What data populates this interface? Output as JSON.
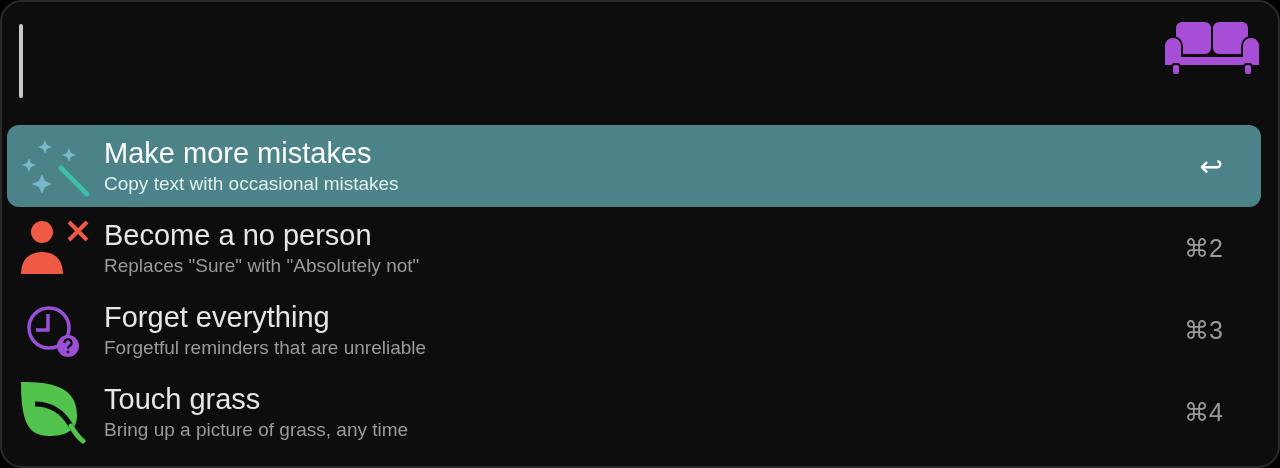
{
  "search": {
    "focused": true
  },
  "items": [
    {
      "kind": "wand",
      "title": "Make more mistakes",
      "subtitle": "Copy text with occasional mistakes",
      "shortcut": "↩",
      "selected": true
    },
    {
      "kind": "person-x",
      "title": "Become a no person",
      "subtitle": "Replaces \"Sure\" with \"Absolutely not\"",
      "shortcut": "⌘2",
      "selected": false
    },
    {
      "kind": "clock-question",
      "title": "Forget everything",
      "subtitle": "Forgetful reminders that are unreliable",
      "shortcut": "⌘3",
      "selected": false
    },
    {
      "kind": "leaf",
      "title": "Touch grass",
      "subtitle": "Bring up a picture of grass, any time",
      "shortcut": "⌘4",
      "selected": false
    }
  ]
}
